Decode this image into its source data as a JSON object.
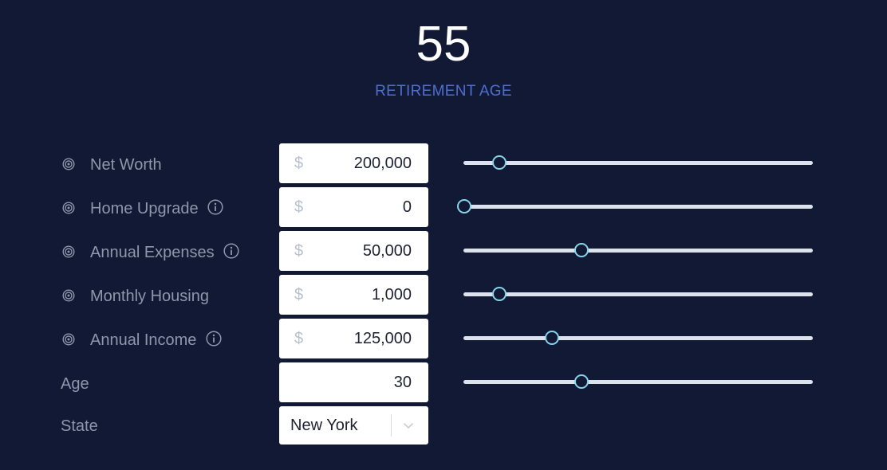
{
  "summary": {
    "age_value": "55",
    "age_label": "RETIREMENT AGE"
  },
  "rows": [
    {
      "label": "Net Worth",
      "prefix": "$",
      "value": "200,000",
      "has_target_icon": true,
      "has_info": false,
      "slider_fraction": 0.1
    },
    {
      "label": "Home Upgrade",
      "prefix": "$",
      "value": "0",
      "has_target_icon": true,
      "has_info": true,
      "slider_fraction": 0.0
    },
    {
      "label": "Annual Expenses",
      "prefix": "$",
      "value": "50,000",
      "has_target_icon": true,
      "has_info": true,
      "slider_fraction": 0.335
    },
    {
      "label": "Monthly Housing",
      "prefix": "$",
      "value": "1,000",
      "has_target_icon": true,
      "has_info": false,
      "slider_fraction": 0.1
    },
    {
      "label": "Annual Income",
      "prefix": "$",
      "value": "125,000",
      "has_target_icon": true,
      "has_info": true,
      "slider_fraction": 0.25
    },
    {
      "label": "Age",
      "prefix": "",
      "value": "30",
      "has_target_icon": false,
      "has_info": false,
      "slider_fraction": 0.335
    }
  ],
  "state": {
    "label": "State",
    "selected": "New York"
  },
  "icons": {
    "target": "target-icon",
    "info": "info-icon",
    "chevron": "chevron-down-icon"
  },
  "colors": {
    "background": "#111935",
    "accent": "#4f6ed1",
    "label_text": "#8e97ab",
    "slider_track": "#dde3ec",
    "slider_thumb_border": "#86d3e8"
  }
}
